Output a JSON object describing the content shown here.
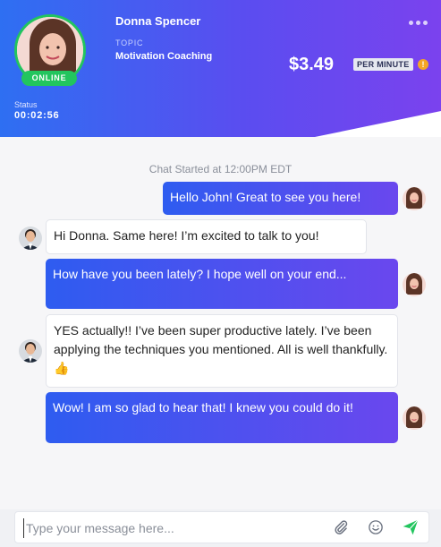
{
  "header": {
    "user_name": "Donna Spencer",
    "online_label": "ONLINE",
    "topic_label": "TOPIC",
    "topic_value": "Motivation Coaching",
    "price": "$3.49",
    "per_minute_label": "PER MINUTE",
    "info_icon_glyph": "!",
    "status_label": "Status",
    "status_time": "00:02:56",
    "more_icon": "more-horizontal-icon",
    "colors": {
      "online": "#22c55e",
      "gradient_start": "#2e6ff2",
      "gradient_end": "#7b42ee",
      "info": "#f5a623"
    }
  },
  "chat": {
    "started_label": "Chat Started at 12:00PM EDT",
    "messages": [
      {
        "sender": "Donna",
        "direction": "outgoing",
        "text": "Hello John! Great to see you here!"
      },
      {
        "sender": "John",
        "direction": "incoming",
        "text": "Hi Donna. Same here! I’m excited to talk to you!"
      },
      {
        "sender": "Donna",
        "direction": "outgoing",
        "text": "How have you been lately?  I hope well on your end..."
      },
      {
        "sender": "John",
        "direction": "incoming",
        "text": "YES actually!! I’ve been super productive lately. I’ve been applying the techniques you mentioned. All is well thankfully. 👍"
      },
      {
        "sender": "Donna",
        "direction": "outgoing",
        "text": "Wow! I am so glad to hear that!  I knew you could do it!"
      }
    ]
  },
  "composer": {
    "placeholder": "Type your message here...",
    "value": "",
    "icons": [
      "paperclip-icon",
      "smiley-icon",
      "send-icon"
    ],
    "send_color": "#22c55e"
  }
}
